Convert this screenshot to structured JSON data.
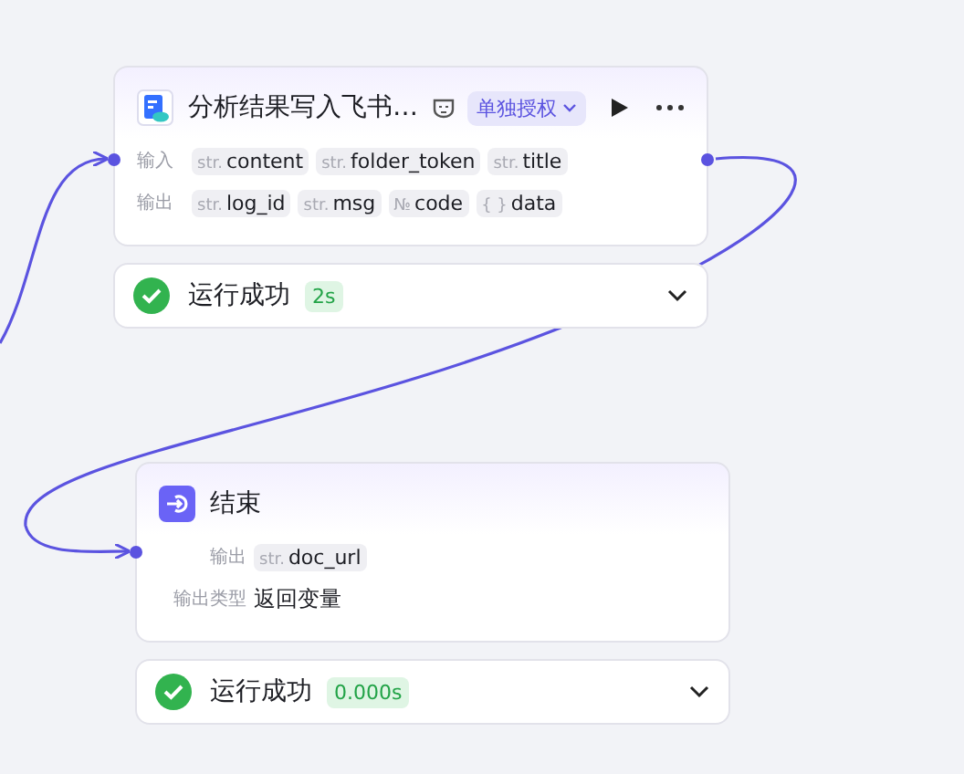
{
  "nodes": [
    {
      "kind": "tool",
      "title": "分析结果写入飞书…",
      "auth": "单独授权",
      "rows": [
        {
          "label": "输入",
          "tags": [
            {
              "type": "str.",
              "name": "content"
            },
            {
              "type": "str.",
              "name": "folder_token"
            },
            {
              "type": "str.",
              "name": "title"
            }
          ]
        },
        {
          "label": "输出",
          "tags": [
            {
              "type": "str.",
              "name": "log_id"
            },
            {
              "type": "str.",
              "name": "msg"
            },
            {
              "type": "№",
              "name": "code"
            },
            {
              "type": "{ }",
              "name": "data"
            }
          ]
        }
      ],
      "status": {
        "text": "运行成功",
        "time": "2s"
      }
    },
    {
      "kind": "end",
      "title": "结束",
      "rows": [
        {
          "label": "输出",
          "tags": [
            {
              "type": "str.",
              "name": "doc_url"
            }
          ]
        },
        {
          "label": "输出类型",
          "value": "返回变量"
        }
      ],
      "status": {
        "text": "运行成功",
        "time": "0.000s"
      }
    }
  ]
}
